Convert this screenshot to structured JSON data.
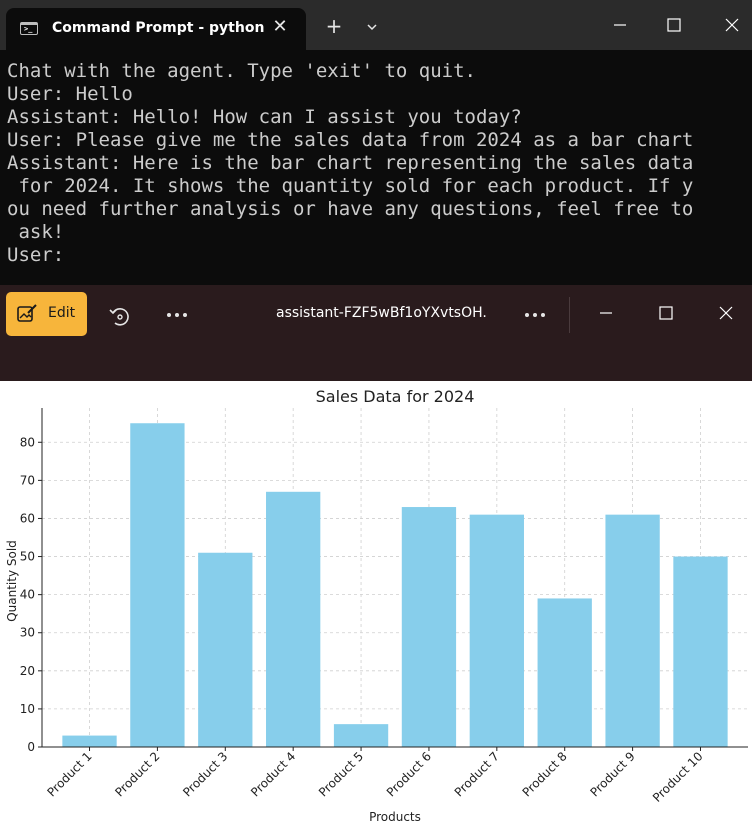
{
  "terminal": {
    "tab_title": "Command Prompt - python  b",
    "tab_icon_glyph": ">_",
    "lines": [
      "Chat with the agent. Type 'exit' to quit.",
      "User: Hello",
      "Assistant: Hello! How can I assist you today?",
      "User: Please give me the sales data from 2024 as a bar chart",
      "Assistant: Here is the bar chart representing the sales data",
      " for 2024. It shows the quantity sold for each product. If y",
      "ou need further analysis or have any questions, feel free to",
      " ask!",
      "User:"
    ]
  },
  "viewer": {
    "edit_label": "Edit",
    "file_title": "assistant-FZF5wBf1oYXvtsOH..."
  },
  "colors": {
    "terminal_bg": "#0c0c0c",
    "titlebar_bg": "#2b2b2b",
    "viewer_bg": "#2a1b1d",
    "accent": "#f7b53b",
    "bar": "#87ceeb"
  },
  "chart_data": {
    "type": "bar",
    "title": "Sales Data for 2024",
    "xlabel": "Products",
    "ylabel": "Quantity Sold",
    "categories": [
      "Product 1",
      "Product 2",
      "Product 3",
      "Product 4",
      "Product 5",
      "Product 6",
      "Product 7",
      "Product 8",
      "Product 9",
      "Product 10"
    ],
    "values": [
      3,
      85,
      51,
      67,
      6,
      63,
      61,
      39,
      61,
      50
    ],
    "ylim": [
      0,
      89
    ],
    "yticks": [
      0,
      10,
      20,
      30,
      40,
      50,
      60,
      70,
      80
    ],
    "grid": true,
    "grid_style": "dashed"
  }
}
